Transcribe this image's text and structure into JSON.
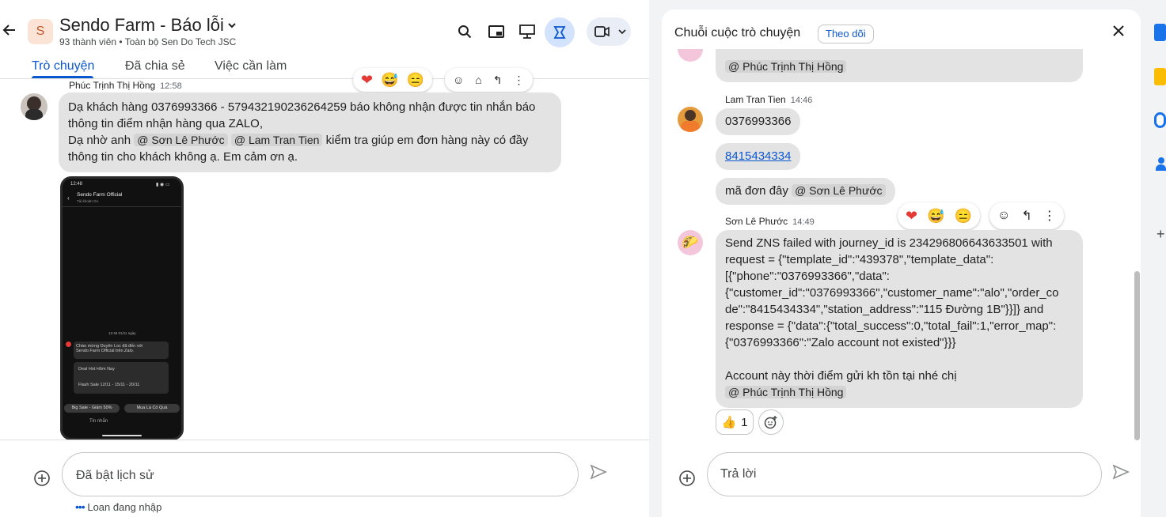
{
  "header": {
    "title": "Sendo Farm - Báo lỗi",
    "subtitle": "93 thành viên  •  Toàn bộ Sen Do Tech JSC",
    "avatar_letter": "S"
  },
  "tabs": [
    {
      "label": "Trò chuyện",
      "active": true
    },
    {
      "label": "Đã chia sẻ",
      "active": false
    },
    {
      "label": "Việc cần làm",
      "active": false
    }
  ],
  "main_message": {
    "sender": "Phúc Trịnh Thị Hồng",
    "time": "12:58",
    "line1": "Dạ khách hàng 0376993366 - 579432190236264259 báo không nhận được tin nhắn báo",
    "line2": "thông tin điểm nhận hàng qua ZALO,",
    "line3_pre": "Dạ nhờ anh",
    "mention1": "@ Sơn Lê Phước",
    "mention2": "@ Lam Tran Tien",
    "line3_post": "kiểm tra giúp em đơn hàng này có đầy",
    "line4": "thông tin cho khách không ạ. Em cảm ơn ạ."
  },
  "phone_screenshot": {
    "time": "12:48",
    "title": "Sendo Farm Official",
    "subtitle": "Tài khoản OA",
    "timestamp": "12:48 01/11 ngày",
    "card_text1": "Chào mừng Duyên Loc đã đến với",
    "card_text2": "Sendo Farm Official trên Zalo.",
    "option1": "Deal Hot Hôm Nay",
    "option2": "Flash Sale 12/11 - 15/11 - 20/11",
    "btn1": "Big Sale - Giảm 50%",
    "btn2": "Mua Là Có Quà",
    "input": "Tin nhắn"
  },
  "composer_left": {
    "placeholder": "Đã bật lịch sử",
    "status": "Loan đang nhập"
  },
  "thread": {
    "title": "Chuỗi cuộc trò chuyện",
    "follow_label": "Theo dõi",
    "top_mention": "@ Phúc Trịnh Thị Hồng",
    "msg2_sender": "Lam Tran Tien",
    "msg2_time": "14:46",
    "msg2_text1": "0376993366",
    "msg2_link": "8415434334",
    "msg2_text3": "mã đơn đây",
    "msg2_mention": "@ Sơn Lê Phước",
    "msg3_sender": "Sơn Lê Phước",
    "msg3_time": "14:49",
    "msg3_lines": [
      "Send ZNS failed with journey_id is 234296806643633501 with",
      "request = {\"template_id\":\"439378\",\"template_data\":",
      "[{\"phone\":\"0376993366\",\"data\":",
      "{\"customer_id\":\"0376993366\",\"customer_name\":\"alo\",\"order_co",
      "de\":\"8415434334\",\"station_address\":\"115 Đường 1B\"}}]} and",
      "response = {\"data\":{\"total_success\":0,\"total_fail\":1,\"error_map\":",
      "{\"0376993366\":\"Zalo account not existed\"}}}"
    ],
    "msg3_after": "Account này thời điểm gửi kh tồn tại nhé chị",
    "msg3_mention": "@ Phúc Trịnh Thị Hồng",
    "reaction_emoji": "👍",
    "reaction_count": "1",
    "reply_placeholder": "Trả lời"
  },
  "colors": {
    "accent": "#0b57d0",
    "bubble": "#e3e3e3",
    "background": "#f1f3f4"
  }
}
